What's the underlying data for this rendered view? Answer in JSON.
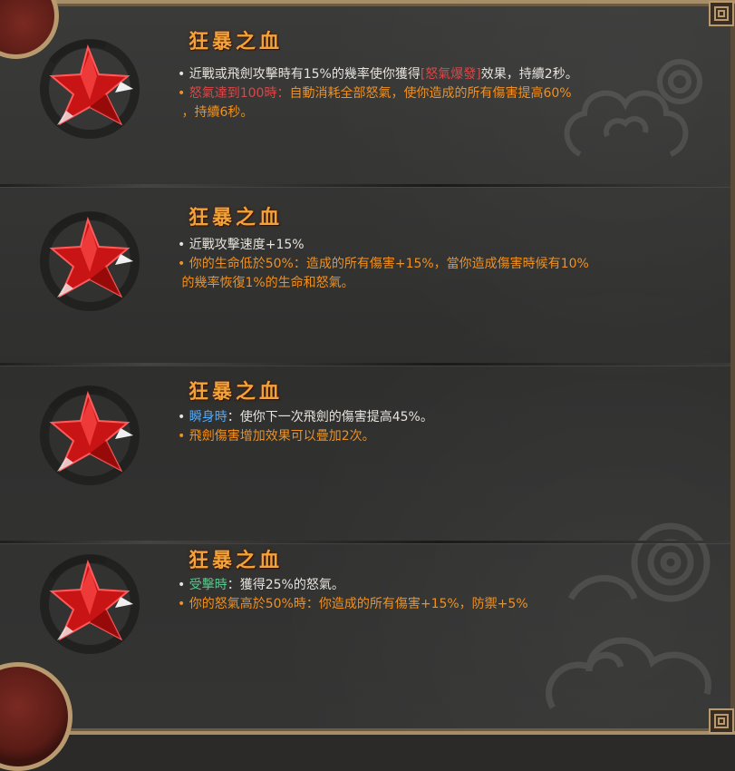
{
  "colors": {
    "title": "#f2a23a",
    "text": "#e6e2dc",
    "orange": "#f0901f",
    "red_keyword": "#d94848",
    "blue_keyword": "#58a8f0",
    "green_keyword": "#55c98b",
    "gem": "#d41818"
  },
  "entries": [
    {
      "icon": "red-star-gem-icon",
      "title": "狂暴之血",
      "lines": [
        {
          "bullet": "•",
          "pre": "近戰或飛劍攻擊時有15%的幾率使你獲得",
          "keyword": "[怒氣爆發]",
          "post": "效果，持續2秒。"
        },
        {
          "bullet": "•",
          "keyword": "怒氣達到100時：",
          "post": "自動消耗全部怒氣，使你造成的所有傷害提高60%"
        },
        {
          "bullet": "",
          "post": "，持續6秒。"
        }
      ]
    },
    {
      "icon": "red-star-gem-icon",
      "title": "狂暴之血",
      "lines": [
        {
          "bullet": "•",
          "pre": "近戰攻擊速度+15%"
        },
        {
          "bullet": "•",
          "post": "你的生命低於50%：造成的所有傷害+15%，當你造成傷害時候有10%"
        },
        {
          "bullet": "",
          "post": "的幾率恢復1%的生命和怒氣。"
        }
      ]
    },
    {
      "icon": "red-star-gem-icon",
      "title": "狂暴之血",
      "lines": [
        {
          "bullet": "•",
          "keyword": "瞬身時",
          "pre": "：使你下一次飛劍的傷害提高45%。"
        },
        {
          "bullet": "•",
          "post": "飛劍傷害增加效果可以疊加2次。"
        }
      ]
    },
    {
      "icon": "red-star-gem-icon",
      "title": "狂暴之血",
      "lines": [
        {
          "bullet": "•",
          "keyword": "受擊時",
          "pre": "：獲得25%的怒氣。"
        },
        {
          "bullet": "•",
          "post": "你的怒氣高於50%時：你造成的所有傷害+15%，防禦+5%"
        }
      ]
    }
  ]
}
